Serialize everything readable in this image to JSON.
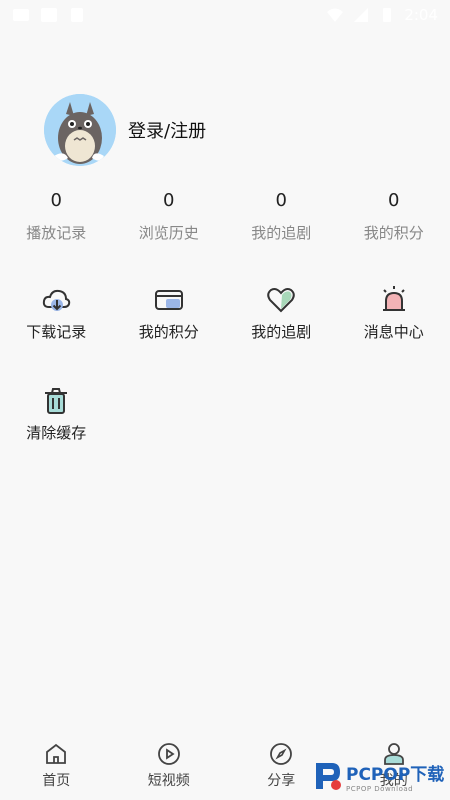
{
  "status_bar": {
    "time": "2:04",
    "icons": [
      "image-icon",
      "notification-icon",
      "app-icon",
      "wifi-icon",
      "signal-icon",
      "battery-icon"
    ]
  },
  "profile": {
    "login_label": "登录/注册",
    "avatar_icon": "totoro-avatar"
  },
  "stats": [
    {
      "value": "0",
      "label": "播放记录"
    },
    {
      "value": "0",
      "label": "浏览历史"
    },
    {
      "value": "0",
      "label": "我的追剧"
    },
    {
      "value": "0",
      "label": "我的积分"
    }
  ],
  "grid": [
    {
      "label": "下载记录",
      "icon": "cloud-download-icon"
    },
    {
      "label": "我的积分",
      "icon": "card-icon"
    },
    {
      "label": "我的追剧",
      "icon": "heart-icon"
    },
    {
      "label": "消息中心",
      "icon": "alarm-icon"
    },
    {
      "label": "清除缓存",
      "icon": "trash-icon"
    }
  ],
  "tabbar": [
    {
      "label": "首页",
      "icon": "home-icon"
    },
    {
      "label": "短视频",
      "icon": "play-icon"
    },
    {
      "label": "分享",
      "icon": "compass-icon"
    },
    {
      "label": "我的",
      "icon": "user-icon"
    }
  ],
  "watermark": {
    "main": "PCPOP下载",
    "sub": "PCPOP Download"
  },
  "colors": {
    "background": "#f8f8f8",
    "avatar_bg": "#a9d7f7",
    "watermark_blue": "#1f62b9",
    "label_gray": "#888888"
  }
}
